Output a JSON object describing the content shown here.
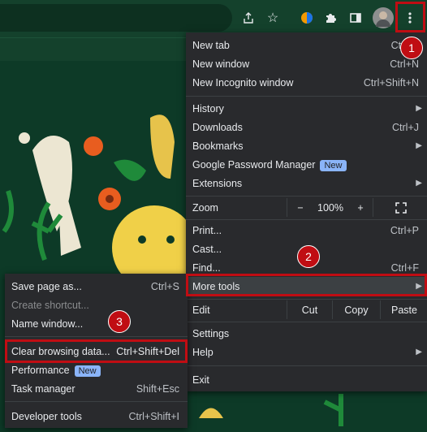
{
  "main_menu": {
    "items": {
      "new_tab": {
        "label": "New tab",
        "shortcut": "Ctrl+T"
      },
      "new_window": {
        "label": "New window",
        "shortcut": "Ctrl+N"
      },
      "new_incognito": {
        "label": "New Incognito window",
        "shortcut": "Ctrl+Shift+N"
      },
      "history": {
        "label": "History"
      },
      "downloads": {
        "label": "Downloads",
        "shortcut": "Ctrl+J"
      },
      "bookmarks": {
        "label": "Bookmarks"
      },
      "password_manager": {
        "label": "Google Password Manager",
        "badge": "New"
      },
      "extensions": {
        "label": "Extensions"
      },
      "zoom": {
        "label": "Zoom",
        "minus": "−",
        "value": "100%",
        "plus": "+"
      },
      "print": {
        "label": "Print...",
        "shortcut": "Ctrl+P"
      },
      "cast": {
        "label": "Cast..."
      },
      "find": {
        "label": "Find...",
        "shortcut": "Ctrl+F"
      },
      "more_tools": {
        "label": "More tools"
      },
      "edit": {
        "label": "Edit",
        "cut": "Cut",
        "copy": "Copy",
        "paste": "Paste"
      },
      "settings": {
        "label": "Settings"
      },
      "help": {
        "label": "Help"
      },
      "exit": {
        "label": "Exit"
      }
    }
  },
  "submenu": {
    "items": {
      "save_page": {
        "label": "Save page as...",
        "shortcut": "Ctrl+S"
      },
      "create_shortcut": {
        "label": "Create shortcut..."
      },
      "name_window": {
        "label": "Name window..."
      },
      "clear_data": {
        "label": "Clear browsing data...",
        "shortcut": "Ctrl+Shift+Del"
      },
      "performance": {
        "label": "Performance",
        "badge": "New"
      },
      "task_manager": {
        "label": "Task manager",
        "shortcut": "Shift+Esc"
      },
      "developer_tools": {
        "label": "Developer tools",
        "shortcut": "Ctrl+Shift+I"
      }
    }
  },
  "markers": {
    "m1": "1",
    "m2": "2",
    "m3": "3"
  },
  "icons": [
    "share-icon",
    "star-icon",
    "extension-puzzle-icon",
    "side-panel-icon",
    "avatar",
    "kebab-menu-icon",
    "fullscreen-icon"
  ],
  "colors": {
    "highlight": "#c00d13",
    "menu_bg": "#292a2d",
    "badge": "#8ab4f8"
  }
}
